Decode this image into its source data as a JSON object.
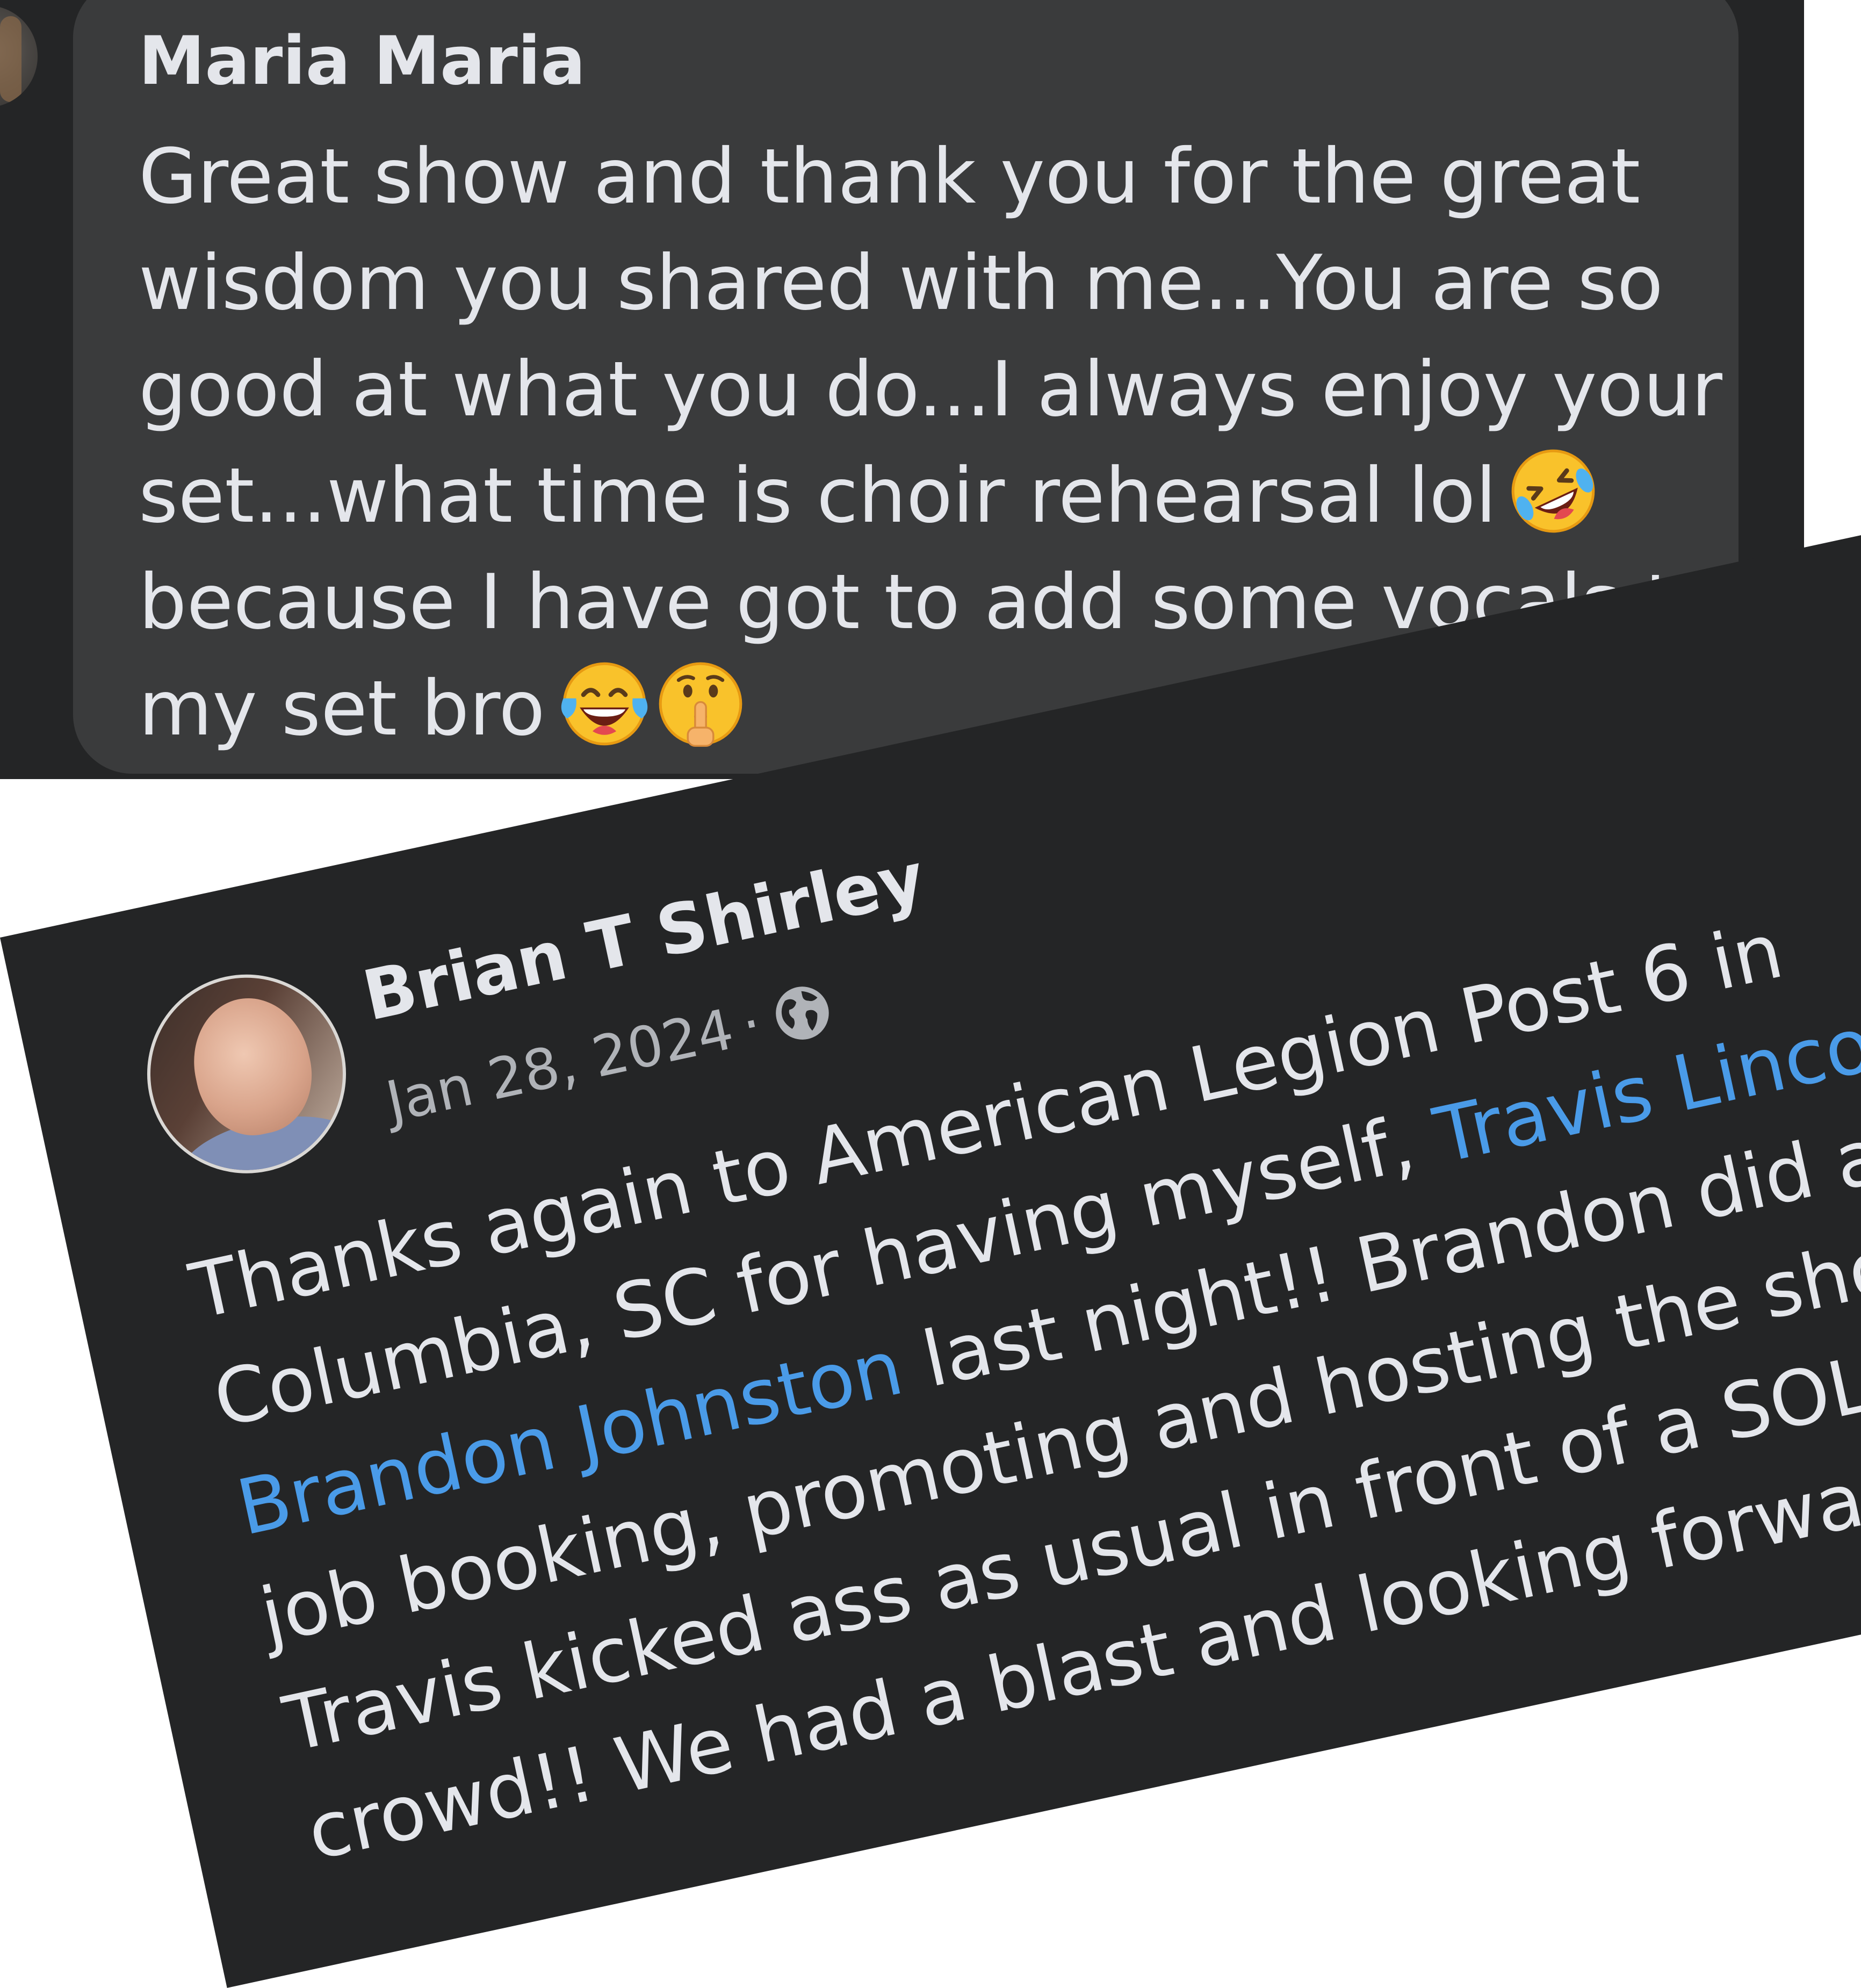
{
  "comment": {
    "author": "Maria Maria",
    "lines": [
      "Great show and thank you for the great",
      "wisdom you shared with me...You are so",
      "good at what you do...I always enjoy your",
      "set...what time is choir rehearsal lol",
      "because I have got to add some vocals to",
      "my set bro"
    ],
    "line4_emoji": "rolling-on-floor-laughing-emoji",
    "line6_emojis": [
      "tears-of-joy-emoji",
      "shushing-face-emoji"
    ]
  },
  "post": {
    "author": "Brian T Shirley",
    "date": "Jan 28, 2024",
    "separator": "·",
    "privacy_icon": "globe-icon",
    "mention_color": "#4a9be8",
    "lines": {
      "l1": "Thanks again to American Legion Post 6 in",
      "l2a": "Columbia, SC for having myself, ",
      "l2_mention": "Travis Lincoln",
      "l2b": " &",
      "l3_mention": "Brandon Johnston",
      "l3b": " last night!! Brandon did a gre",
      "l4": "job booking, promoting and hosting the show a",
      "l5": "Travis kicked ass as usual in front of a SOLD OU",
      "l6": "crowd!! We had a blast and looking forward to"
    }
  },
  "colors": {
    "background": "#242526",
    "bubble": "#3a3b3c",
    "text": "#e4e6eb",
    "secondary_text": "#b0b3b8",
    "link": "#4a9be8"
  }
}
